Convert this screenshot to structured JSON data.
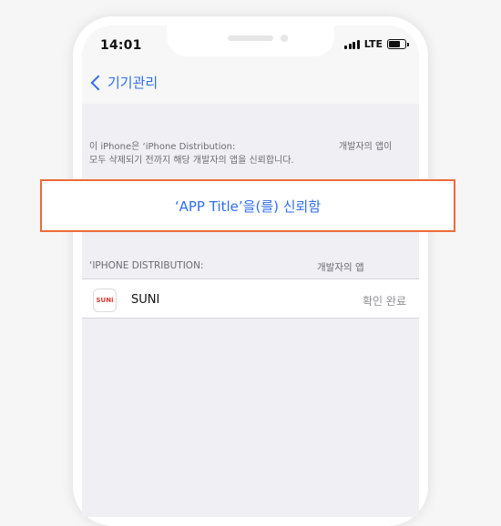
{
  "status_bar": {
    "time": "14:01",
    "network": "LTE"
  },
  "nav": {
    "back_label": "기기관리"
  },
  "info": {
    "line1": "이 iPhone은 ‘iPhone Distribution:",
    "line1_right": "개발자의 앱이",
    "line2": "모두 삭제되기 전까지 해당 개발자의 앱을 신뢰합니다."
  },
  "trust": {
    "label": "‘APP Title’을(를) 신뢰함"
  },
  "section": {
    "left": "‘IPHONE DISTRIBUTION:",
    "right": "개발자의 앱"
  },
  "app": {
    "icon_text": "SUNi",
    "name": "SUNI",
    "status": "확인 완료"
  },
  "colors": {
    "accent": "#2f6ef2",
    "highlight_border": "#ef6a3c",
    "screen_bg": "#efeff4"
  }
}
